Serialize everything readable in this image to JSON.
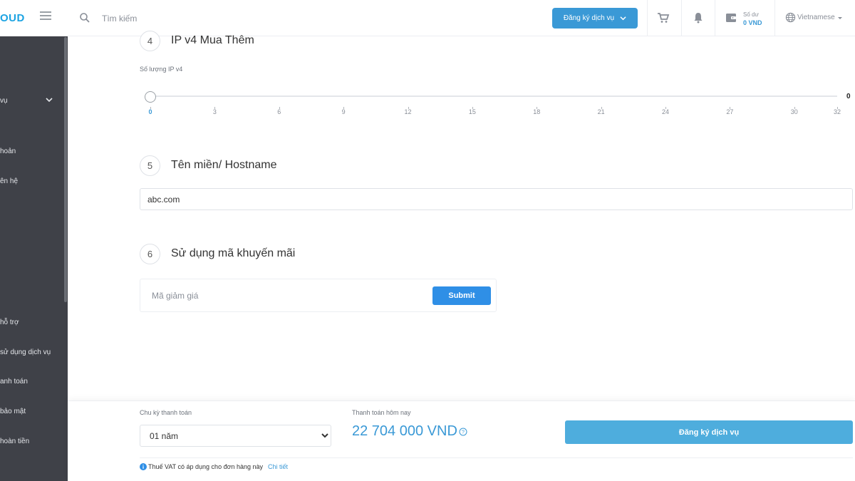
{
  "sidebar": {
    "logo": "OUD",
    "items": [
      {
        "label": "vụ",
        "has_chevron": true
      },
      {
        "label": "hoản"
      },
      {
        "label": "ên hệ"
      },
      {
        "label": "hỗ trợ"
      },
      {
        "label": "sử dụng dịch vụ"
      },
      {
        "label": "anh toán"
      },
      {
        "label": "bảo mật"
      },
      {
        "label": "hoàn tiền"
      }
    ]
  },
  "header": {
    "search_placeholder": "Tìm kiếm",
    "register_label": "Đăng ký dịch vụ",
    "balance_label": "Số dư",
    "balance_value": "0 VND",
    "language": "Vietnamese"
  },
  "steps": {
    "ip": {
      "number": "4",
      "title": "IP v4 Mua Thêm",
      "field_label": "Số lượng IP v4",
      "value": "0",
      "min": 0,
      "max": 32,
      "current": 0,
      "ticks": [
        "0",
        "3",
        "6",
        "9",
        "12",
        "15",
        "18",
        "21",
        "24",
        "27",
        "30",
        "32"
      ]
    },
    "hostname": {
      "number": "5",
      "title": "Tên miền/ Hostname",
      "value": "abc.com"
    },
    "promo": {
      "number": "6",
      "title": "Sử dụng mã khuyến mãi",
      "placeholder": "Mã giảm giá",
      "submit_label": "Submit"
    }
  },
  "footer": {
    "cycle_label": "Chu kỳ thanh toán",
    "cycle_value": "01 năm",
    "today_label": "Thanh toán hôm nay",
    "total": "22 704 000 VND",
    "register_label": "Đăng ký dịch vụ",
    "vat_note": "Thuế VAT có áp dụng cho đơn hàng này",
    "vat_link": "Chi tiết"
  },
  "colors": {
    "accent": "#3a99d6",
    "sidebar_bg": "#3f4148",
    "logo": "#1ba3e2"
  }
}
